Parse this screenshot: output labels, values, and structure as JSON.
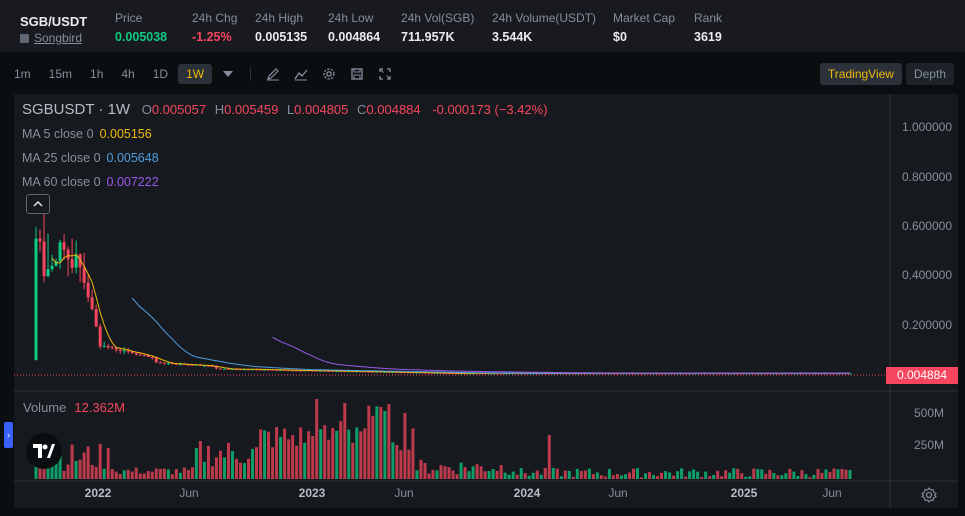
{
  "ticker": {
    "symbol": "SGB/USDT",
    "name": "Songbird",
    "stats": [
      {
        "label": "Price",
        "value": "0.005038",
        "color": "#0ecb81"
      },
      {
        "label": "24h Chg",
        "value": "-1.25%",
        "color": "#f6465d"
      },
      {
        "label": "24h High",
        "value": "0.005135",
        "color": "#eaecef"
      },
      {
        "label": "24h Low",
        "value": "0.004864",
        "color": "#eaecef"
      },
      {
        "label": "24h Vol(SGB)",
        "value": "711.957K",
        "color": "#eaecef"
      },
      {
        "label": "24h Volume(USDT)",
        "value": "3.544K",
        "color": "#eaecef"
      },
      {
        "label": "Market Cap",
        "value": "$0",
        "color": "#eaecef"
      },
      {
        "label": "Rank",
        "value": "3619",
        "color": "#eaecef"
      }
    ]
  },
  "toolbar": {
    "intervals": [
      "1m",
      "15m",
      "1h",
      "4h",
      "1D",
      "1W"
    ],
    "active_interval": "1W",
    "icons": [
      "dropdown-caret-icon",
      "pen-icon",
      "indicator-icon",
      "settings-icon",
      "save-icon",
      "expand-icon"
    ],
    "view_buttons": [
      "TradingView",
      "Depth"
    ],
    "active_view": "TradingView"
  },
  "chart": {
    "title": "SGBUSDT · 1W",
    "ohlc": {
      "o_label": "O",
      "o": "0.005057",
      "h_label": "H",
      "h": "0.005459",
      "l_label": "L",
      "l": "0.004805",
      "c_label": "C",
      "c": "0.004884",
      "change": "-0.000173 (−3.42%)"
    },
    "ma": [
      {
        "label": "MA 5 close 0",
        "value": "0.005156",
        "color": "#f0b90b"
      },
      {
        "label": "MA 25 close 0",
        "value": "0.005648",
        "color": "#4f9cde"
      },
      {
        "label": "MA 60 close 0",
        "value": "0.007222",
        "color": "#9b59ec"
      }
    ],
    "price_axis": [
      "1.000000",
      "0.800000",
      "0.600000",
      "0.400000",
      "0.200000"
    ],
    "last_price": "0.004884",
    "volume_label": "Volume",
    "volume_value": "12.362M",
    "volume_axis": [
      "500M",
      "250M"
    ],
    "time_axis": [
      {
        "label": "2022",
        "bold": true
      },
      {
        "label": "Jun",
        "bold": false
      },
      {
        "label": "2023",
        "bold": true
      },
      {
        "label": "Jun",
        "bold": false
      },
      {
        "label": "2024",
        "bold": true
      },
      {
        "label": "Jun",
        "bold": false
      },
      {
        "label": "2025",
        "bold": true
      },
      {
        "label": "Jun",
        "bold": false
      }
    ],
    "colors": {
      "up": "#0ecb81",
      "down": "#f6465d"
    }
  },
  "chart_data": {
    "type": "candlestick",
    "title": "SGBUSDT · 1W",
    "ylim": [
      0,
      1.1
    ],
    "x_range": [
      "2021-09",
      "2025-07"
    ],
    "series": [
      {
        "name": "MA 5 close 0",
        "last": 0.005156
      },
      {
        "name": "MA 25 close 0",
        "last": 0.005648
      },
      {
        "name": "MA 60 close 0",
        "last": 0.007222
      }
    ],
    "last": {
      "open": 0.005057,
      "high": 0.005459,
      "low": 0.004805,
      "close": 0.004884
    },
    "volume_last": "12.362M"
  }
}
